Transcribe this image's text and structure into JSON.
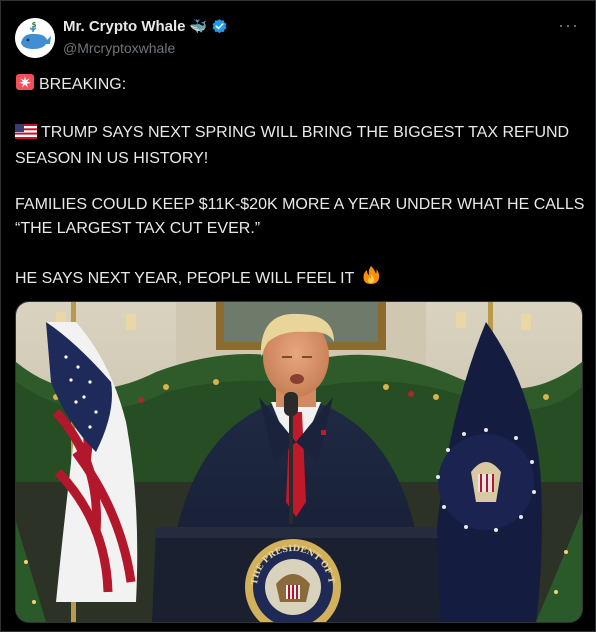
{
  "author": {
    "display_name": "Mr. Crypto Whale",
    "emoji": "🐳",
    "handle": "@Mrcryptoxwhale",
    "avatar_icon": "whale-avatar-icon",
    "verified_color": "#1d9bf0"
  },
  "menu": {
    "more_label": "···"
  },
  "tweet": {
    "breaking": "BREAKING:",
    "paragraph1": "TRUMP SAYS NEXT SPRING WILL BRING THE BIGGEST TAX REFUND SEASON IN US HISTORY!",
    "paragraph2": "FAMILIES COULD KEEP $11K-$20K MORE A YEAR UNDER WHAT HE CALLS “THE LARGEST TAX CUT EVER.”",
    "paragraph3": "HE SAYS NEXT YEAR, PEOPLE WILL FEEL IT",
    "icons": [
      "siren-icon",
      "us-flag-icon",
      "fire-icon"
    ]
  },
  "media": {
    "seal_text": "THE PRESIDENT OF THE UNITED STATES",
    "description_icon": "video-still-image"
  },
  "colors": {
    "background": "#000000",
    "text": "#e7e9ea",
    "muted": "#71767b",
    "border": "#2f3336"
  }
}
